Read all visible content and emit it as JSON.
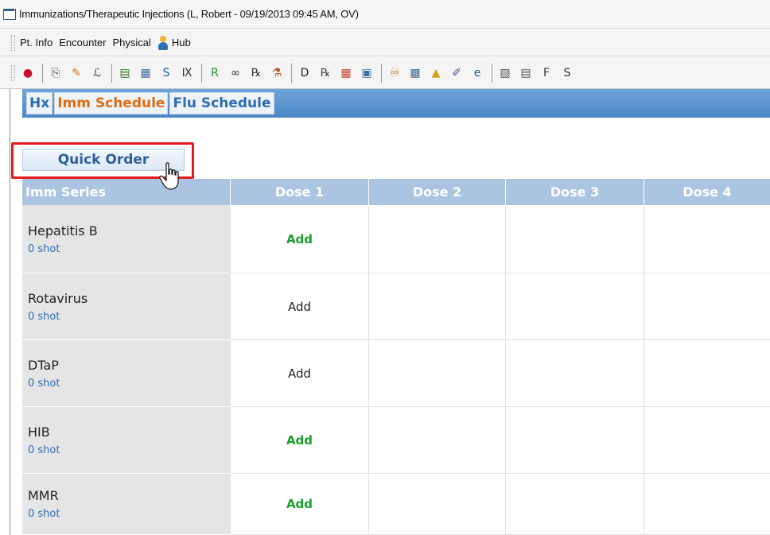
{
  "window": {
    "title": "Immunizations/Therapeutic Injections (L, Robert  - 09/19/2013  09:45 AM, OV)"
  },
  "menu": {
    "items": [
      "Pt. Info",
      "Encounter",
      "Physical",
      "Hub"
    ]
  },
  "toolbar": {
    "buttons": [
      {
        "icon": "alert-icon",
        "glyph": "●",
        "color": "#c8102e"
      },
      {
        "icon": "copy-icon",
        "glyph": "⎘",
        "color": "#555"
      },
      {
        "icon": "syringe-icon",
        "glyph": "✎",
        "color": "#d9741c"
      },
      {
        "icon": "sign-icon",
        "glyph": "ℒ",
        "color": "#333"
      },
      {
        "icon": "note-icon",
        "glyph": "▤",
        "color": "#3b6c2b"
      },
      {
        "icon": "family-icon",
        "glyph": "▦",
        "color": "#3d6aa0"
      },
      {
        "icon": "s-icon",
        "glyph": "S",
        "color": "#1f5fa8"
      },
      {
        "icon": "ix-icon",
        "glyph": "Ⅸ",
        "color": "#333"
      },
      {
        "icon": "r-icon",
        "glyph": "R",
        "color": "#1e8f2a"
      },
      {
        "icon": "glasses-icon",
        "glyph": "∞",
        "color": "#333"
      },
      {
        "icon": "re-icon",
        "glyph": "℞",
        "color": "#333"
      },
      {
        "icon": "lab-icon",
        "glyph": "⚗",
        "color": "#b54b1a"
      },
      {
        "icon": "dx-icon",
        "glyph": "D",
        "color": "#222"
      },
      {
        "icon": "rx-icon",
        "glyph": "℞",
        "color": "#444"
      },
      {
        "icon": "calendar-icon",
        "glyph": "▦",
        "color": "#c63c2c"
      },
      {
        "icon": "imaging-icon",
        "glyph": "▣",
        "color": "#3b6ea5"
      },
      {
        "icon": "binoculars-icon",
        "glyph": "♾",
        "color": "#b07a1a"
      },
      {
        "icon": "print-icon",
        "glyph": "▩",
        "color": "#4a6c8c"
      },
      {
        "icon": "bell-icon",
        "glyph": "▲",
        "color": "#d4a017"
      },
      {
        "icon": "pen-icon",
        "glyph": "✐",
        "color": "#6b4a8a"
      },
      {
        "icon": "browser-icon",
        "glyph": "e",
        "color": "#1b5ea8"
      },
      {
        "icon": "doc-icon",
        "glyph": "▨",
        "color": "#555"
      },
      {
        "icon": "form-icon",
        "glyph": "▤",
        "color": "#555"
      },
      {
        "icon": "fm-icon",
        "glyph": "F",
        "color": "#333"
      },
      {
        "icon": "se-icon",
        "glyph": "S",
        "color": "#333"
      }
    ]
  },
  "tabs": [
    {
      "label": "Hx",
      "active": false
    },
    {
      "label": "Imm Schedule",
      "active": true
    },
    {
      "label": "Flu Schedule",
      "active": false
    }
  ],
  "quick_order": {
    "label": "Quick Order"
  },
  "grid": {
    "headers": [
      "Imm Series",
      "Dose 1",
      "Dose 2",
      "Dose 3",
      "Dose 4"
    ],
    "rows": [
      {
        "series": "Hepatitis B",
        "shots": "0 shot",
        "dose1": "Add",
        "dose1_style": "green"
      },
      {
        "series": "Rotavirus",
        "shots": "0 shot",
        "dose1": "Add",
        "dose1_style": "dark"
      },
      {
        "series": "DTaP",
        "shots": "0 shot",
        "dose1": "Add",
        "dose1_style": "dark"
      },
      {
        "series": "HIB",
        "shots": "0 shot",
        "dose1": "Add",
        "dose1_style": "green"
      },
      {
        "series": "MMR",
        "shots": "0 shot",
        "dose1": "Add",
        "dose1_style": "green"
      }
    ]
  },
  "colors": {
    "tab_active": "#e06c12",
    "tab_inactive": "#2d6db6",
    "header_bg": "#aac4e2",
    "add_green": "#19a12d",
    "highlight": "#e31b1b"
  }
}
